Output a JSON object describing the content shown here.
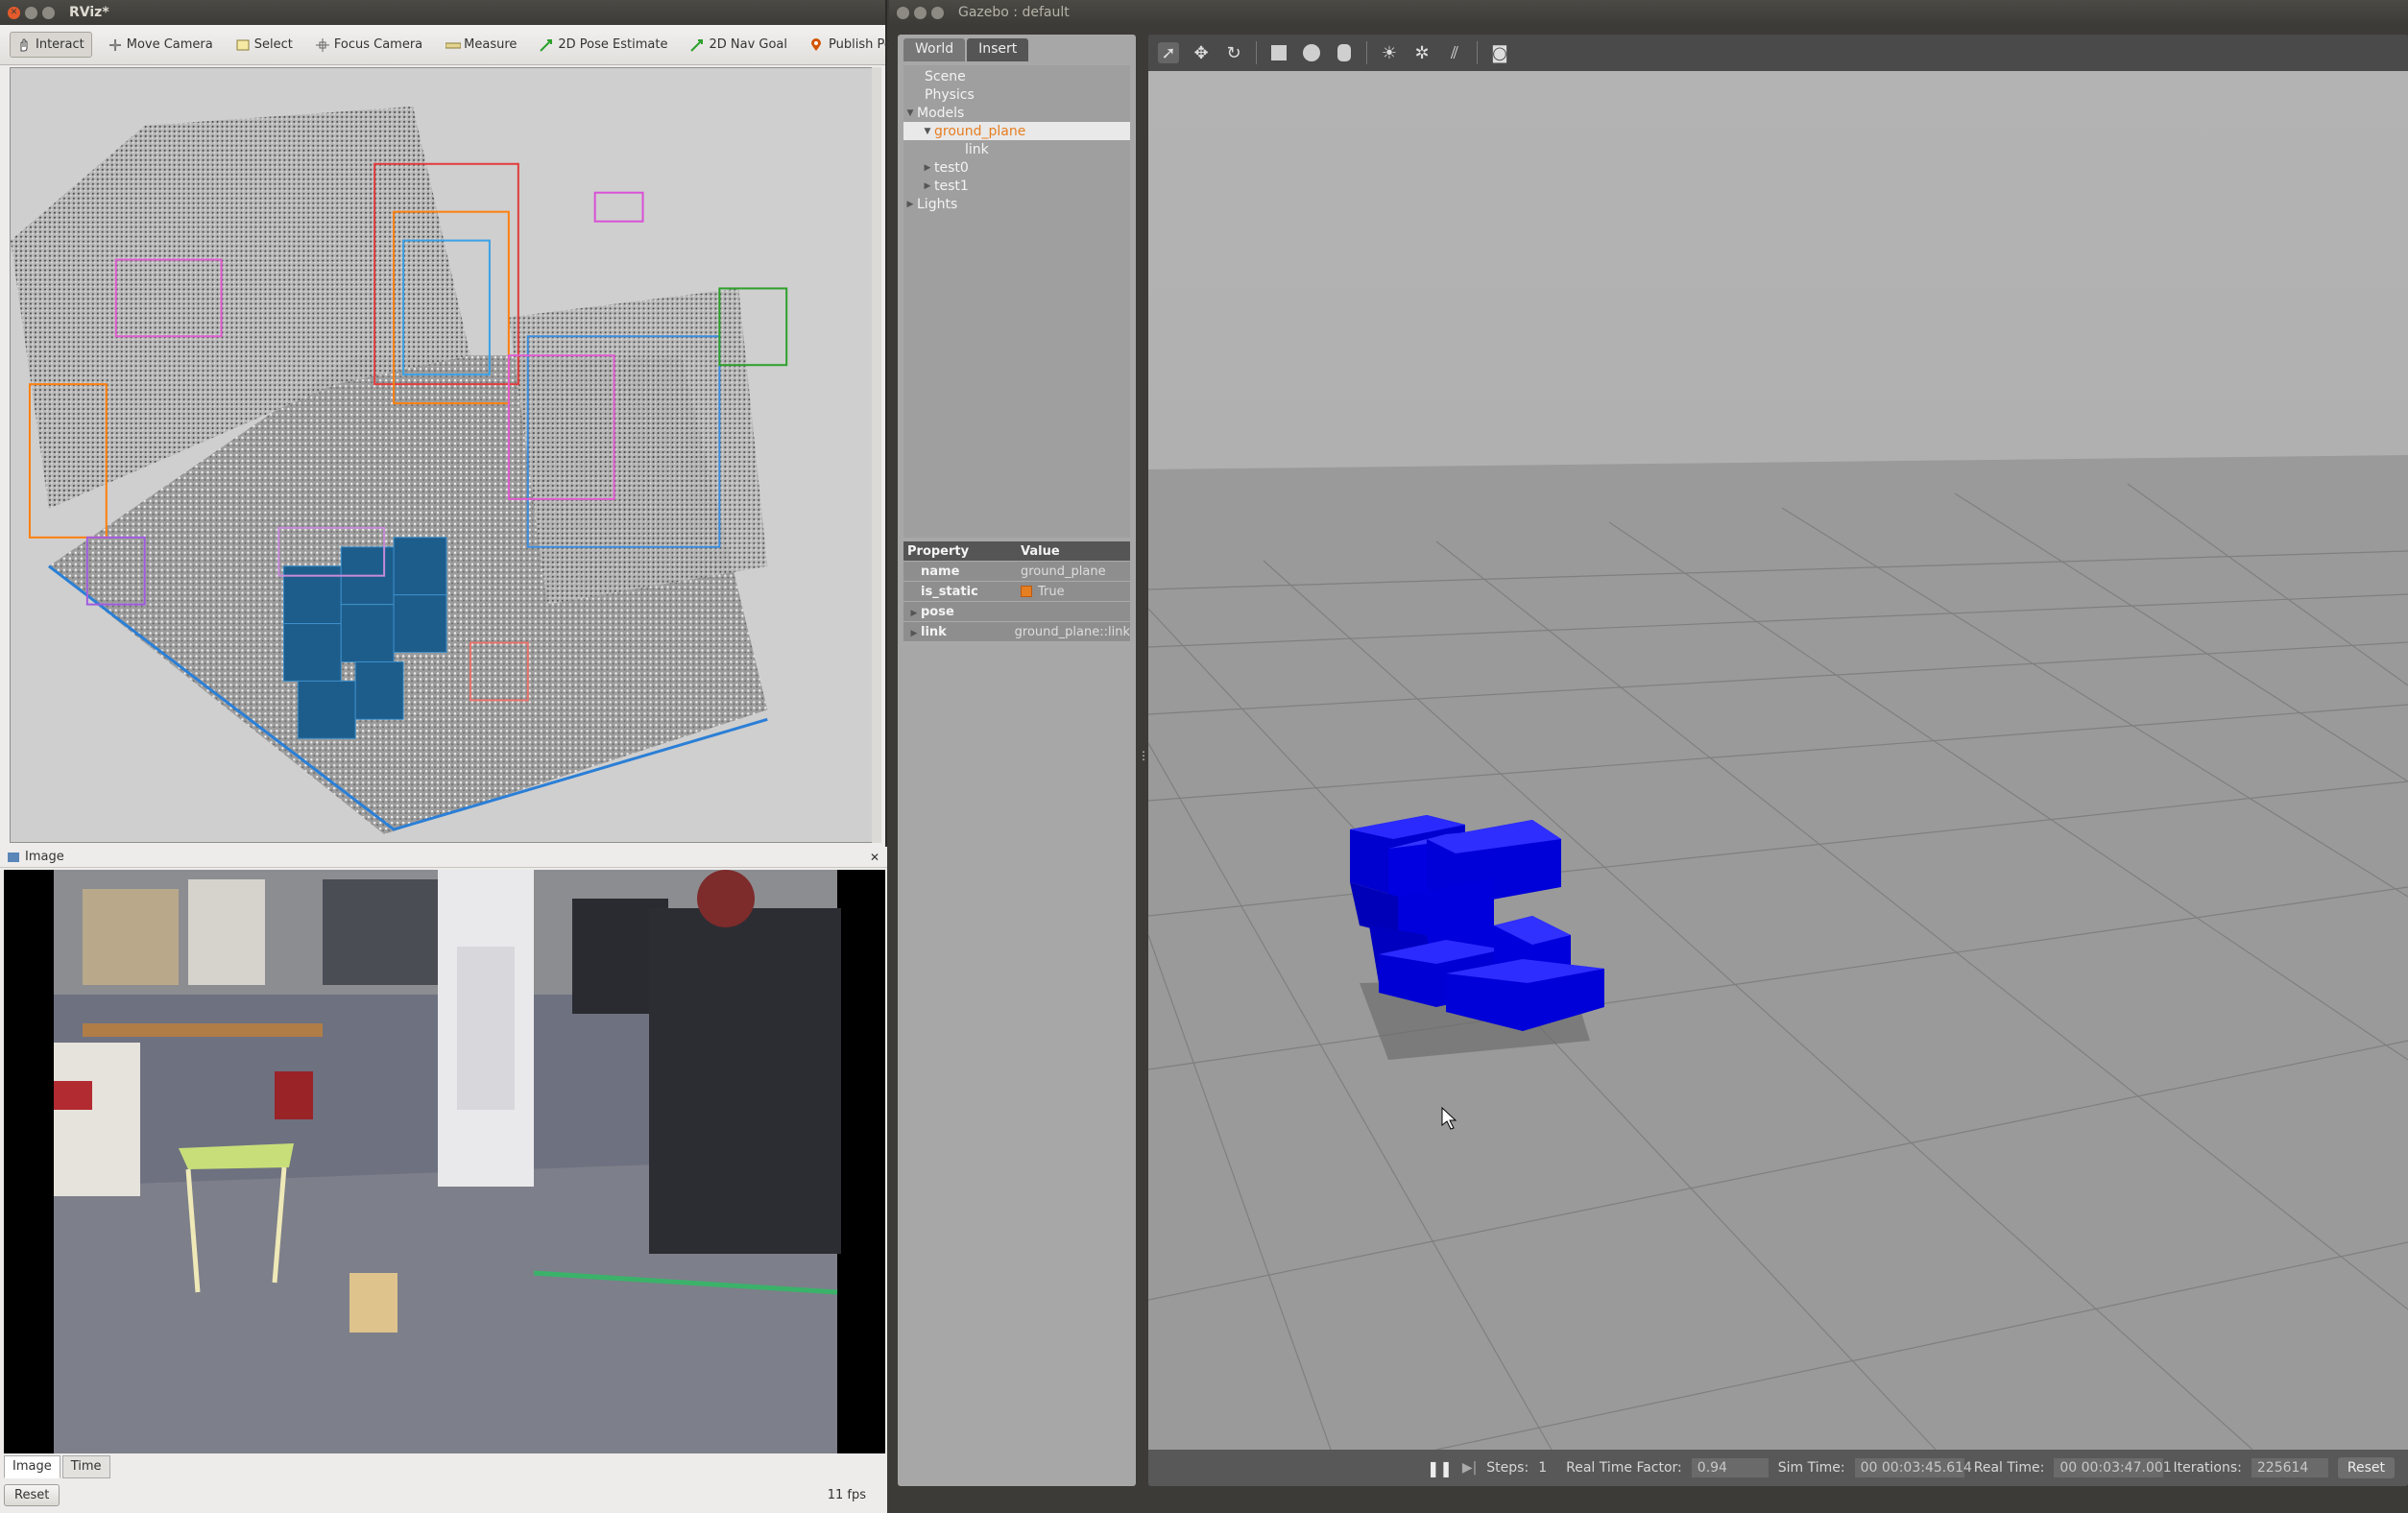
{
  "rviz": {
    "title": "RViz*",
    "tools": [
      {
        "label": "Interact",
        "icon": "hand-pointer-icon"
      },
      {
        "label": "Move Camera",
        "icon": "move-camera-icon"
      },
      {
        "label": "Select",
        "icon": "select-box-icon"
      },
      {
        "label": "Focus Camera",
        "icon": "focus-camera-icon"
      },
      {
        "label": "Measure",
        "icon": "ruler-icon"
      },
      {
        "label": "2D Pose Estimate",
        "icon": "green-arrow-icon"
      },
      {
        "label": "2D Nav Goal",
        "icon": "green-arrow-icon"
      },
      {
        "label": "Publish Point",
        "icon": "map-pin-icon"
      }
    ],
    "image_panel": {
      "title": "Image",
      "tabs": [
        "Image",
        "Time"
      ],
      "reset_label": "Reset",
      "fps": "11 fps"
    }
  },
  "gazebo": {
    "title": "Gazebo : default",
    "tabs": [
      "World",
      "Insert"
    ],
    "tree": {
      "scene": "Scene",
      "physics": "Physics",
      "models": "Models",
      "ground_plane": "ground_plane",
      "link": "link",
      "test0": "test0",
      "test1": "test1",
      "lights": "Lights"
    },
    "properties": {
      "header": [
        "Property",
        "Value"
      ],
      "rows": [
        {
          "name": "name",
          "value": "ground_plane"
        },
        {
          "name": "is_static",
          "value": "True"
        },
        {
          "name": "pose",
          "value": ""
        },
        {
          "name": "link",
          "value": "ground_plane::link"
        }
      ]
    },
    "status": {
      "steps_label": "Steps:",
      "steps_value": "1",
      "rtf_label": "Real Time Factor:",
      "rtf_value": "0.94",
      "sim_time_label": "Sim Time:",
      "sim_time_value": "00 00:03:45.614",
      "real_time_label": "Real Time:",
      "real_time_value": "00 00:03:47.001",
      "iterations_label": "Iterations:",
      "iterations_value": "225614",
      "reset_label": "Reset"
    },
    "colors": {
      "selection": "#e67e22",
      "blocks": "#0000e6"
    }
  }
}
